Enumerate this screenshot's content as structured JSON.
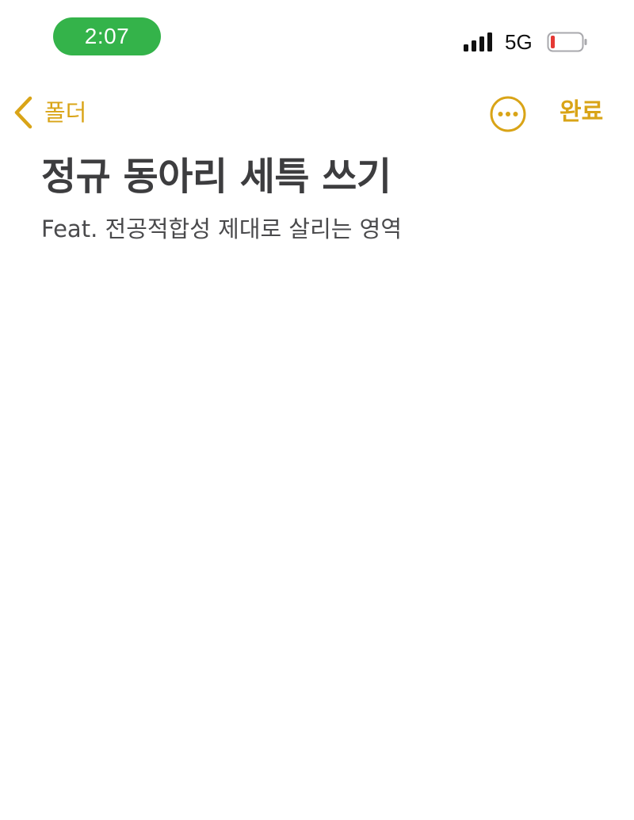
{
  "status_bar": {
    "time": "2:07",
    "network": "5G",
    "signal_icon": "signal-bars-icon",
    "battery_icon": "battery-low-icon",
    "battery_level_percent": 10,
    "time_pill_color": "#34b34a",
    "battery_level_color": "#e53935"
  },
  "nav": {
    "back_label": "폴더",
    "back_icon": "chevron-left-icon",
    "more_icon": "ellipsis-circle-icon",
    "done_label": "완료",
    "accent_color": "#d9a417"
  },
  "note": {
    "title": "정규 동아리 세특 쓰기",
    "subtitle": "Feat. 전공적합성 제대로 살리는 영역",
    "body": ""
  }
}
